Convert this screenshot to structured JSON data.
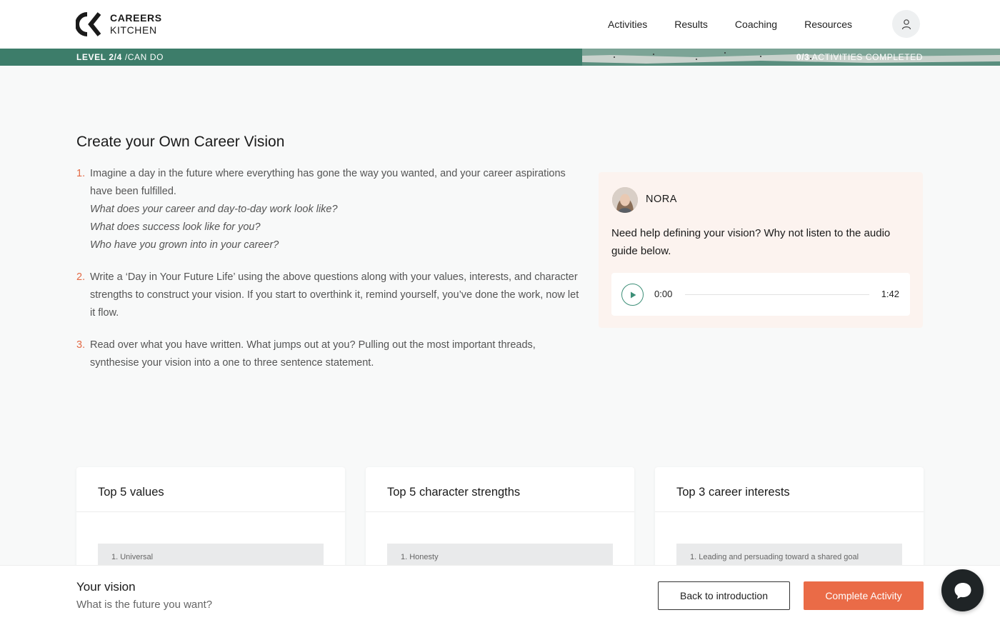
{
  "brand": {
    "line1": "CAREERS",
    "line2": "KITCHEN"
  },
  "nav": {
    "items": [
      {
        "label": "Activities"
      },
      {
        "label": "Results"
      },
      {
        "label": "Coaching"
      },
      {
        "label": "Resources"
      }
    ],
    "account_icon": "user-icon"
  },
  "level_bar": {
    "level": "LEVEL 2/4",
    "stage": "/CAN DO",
    "progress": "0/3",
    "progress_label": "ACTIVITIES COMPLETED"
  },
  "activity": {
    "title": "Create your Own Career Vision",
    "steps": [
      {
        "num": "1.",
        "text": "Imagine a day in the future where everything has gone the way you wanted, and your career aspirations have been fulfilled.",
        "questions": [
          "What does your career and day-to-day work look like?",
          "What does success look like for you?",
          "Who have you grown into in your career?"
        ]
      },
      {
        "num": "2.",
        "text": "Write a ‘Day in Your Future Life’  using the above questions along with your values, interests, and character strengths to construct your vision. If you start to overthink it, remind yourself, you’ve done the work, now let it flow."
      },
      {
        "num": "3.",
        "text": "Read over what you have written. What jumps out at you? Pulling out the most important threads, synthesise your vision into a one to three sentence statement."
      }
    ]
  },
  "coach": {
    "name": "NORA",
    "message": "Need help defining your vision? Why not listen to the audio guide below.",
    "audio": {
      "current": "0:00",
      "duration": "1:42",
      "played_fraction": 0
    }
  },
  "cards": [
    {
      "title": "Top 5 values",
      "first_item": "1. Universal"
    },
    {
      "title": "Top 5 character strengths",
      "first_item": "1. Honesty"
    },
    {
      "title": "Top 3 career interests",
      "first_item": "1. Leading and persuading toward a shared goal"
    }
  ],
  "footer": {
    "title": "Your vision",
    "subtitle": "What is the future you want?",
    "back_label": "Back to introduction",
    "complete_label": "Complete Activity"
  },
  "colors": {
    "accent": "#ea6b47",
    "brand_green": "#3d7d6a",
    "coach_bg": "#fcf3ef"
  }
}
